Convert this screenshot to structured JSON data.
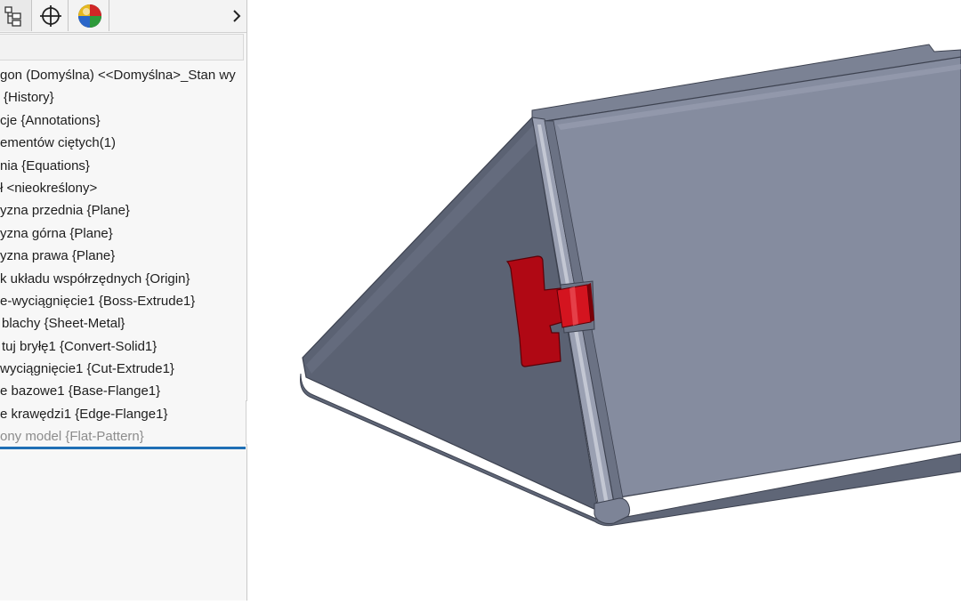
{
  "panel_tabs": [
    {
      "name": "feature-manager-tab",
      "icon": "feature-tree-icon"
    },
    {
      "name": "dimxpert-tab",
      "icon": "crosshair-icon"
    },
    {
      "name": "display-manager-tab",
      "icon": "appearance-sphere-icon"
    }
  ],
  "more_tabs_icon": "chevron-right-icon",
  "tree": {
    "items": [
      {
        "label": "gon (Domyślna) <<Domyślna>_Stan wy"
      },
      {
        "label": "{History}"
      },
      {
        "label": "cje {Annotations}"
      },
      {
        "label": "ementów ciętych(1)"
      },
      {
        "label": "nia {Equations}"
      },
      {
        "label": "ł <nieokreślony>"
      },
      {
        "label": "yzna przednia {Plane}"
      },
      {
        "label": "yzna górna {Plane}"
      },
      {
        "label": "yzna prawa {Plane}"
      },
      {
        "label": "k układu współrzędnych {Origin}"
      },
      {
        "label": "e-wyciągnięcie1 {Boss-Extrude1}"
      },
      {
        "label": "blachy {Sheet-Metal}"
      },
      {
        "label": "tuj bryłę1 {Convert-Solid1}"
      },
      {
        "label": "wyciągnięcie1 {Cut-Extrude1}"
      },
      {
        "label": "e bazowe1 {Base-Flange1}"
      },
      {
        "label": "e krawędzi1 {Edge-Flange1}"
      },
      {
        "label": "ony model {Flat-Pattern}"
      }
    ]
  },
  "colors": {
    "model_dark": "#5b6273",
    "model_light": "#848b9e",
    "model_edge": "#3d4250",
    "tab_highlight": "#c8102e",
    "rollback_bar": "#1f6fb5"
  }
}
